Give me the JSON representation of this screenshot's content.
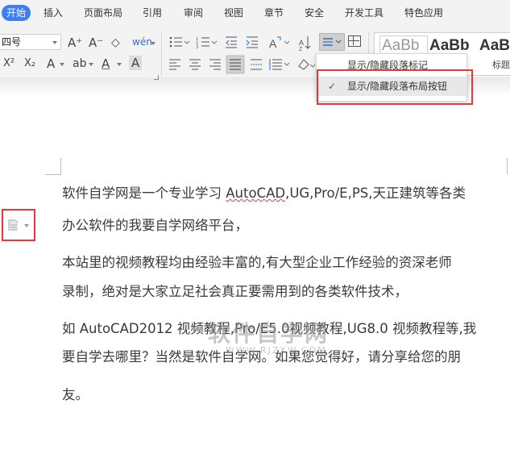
{
  "menu": {
    "items": [
      "开始",
      "插入",
      "页面布局",
      "引用",
      "审阅",
      "视图",
      "章节",
      "安全",
      "开发工具",
      "特色应用"
    ],
    "active_index": 0
  },
  "ribbon": {
    "font_size_value": "四号",
    "font_row1": [
      "A⁺",
      "A⁻",
      "◇",
      "wén"
    ],
    "font_row2": [
      "X²",
      "X₂",
      "A",
      "ab",
      "A",
      "A"
    ],
    "para_row2_glyph": "⋮A",
    "styles": {
      "samples": [
        "AaBb",
        "AaBb",
        "AaB"
      ],
      "labels": [
        "标题"
      ]
    }
  },
  "dropdown": {
    "items": [
      {
        "label": "显示/隐藏段落标记",
        "checked": false
      },
      {
        "label": "显示/隐藏段落布局按钮",
        "checked": true
      }
    ],
    "check_glyph": "✓"
  },
  "document": {
    "lines": [
      {
        "pre": "软件自学网是一个专业学习 ",
        "underline": "AutoCAD",
        "post": ",UG,Pro/E,PS,天正建筑等各类"
      },
      {
        "pre": "办公软件的我要自学网络平台，",
        "underline": "",
        "post": ""
      },
      {
        "pre": "本站里的视频教程均由经验丰富的,有大型企业工作经验的资深老师",
        "underline": "",
        "post": ""
      },
      {
        "pre": "录制，绝对是大家立足社会真正要需用到的各类软件技术，",
        "underline": "",
        "post": ""
      },
      {
        "pre": "如 AutoCAD2012 视频教程,Pro/E5.0视频教程,UG8.0 视频教程等,我",
        "underline": "",
        "post": ""
      },
      {
        "pre": "要自学去哪里？当然是软件自学网。如果您觉得好，请分享给您的朋",
        "underline": "",
        "post": ""
      },
      {
        "pre": "友。",
        "underline": "",
        "post": ""
      }
    ],
    "watermark": {
      "main": "软件自学网",
      "sub": "WWW.RJZXW.COM"
    }
  },
  "colors": {
    "accent": "#3d7ef6",
    "highlight_box": "#e23a3a",
    "ribbon_bg": "#f3f3f3"
  }
}
